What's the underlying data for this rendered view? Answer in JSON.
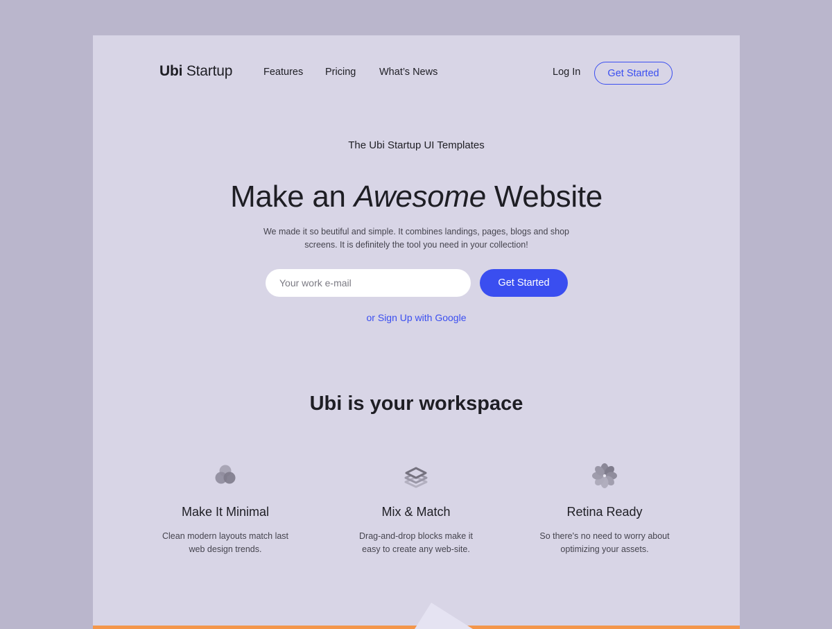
{
  "nav": {
    "brand_bold": "Ubi",
    "brand_regular": " Startup",
    "links": [
      "Features",
      "Pricing",
      "What’s News"
    ],
    "login_label": "Log In",
    "cta_label": "Get Started"
  },
  "hero": {
    "eyebrow": "The Ubi Startup UI Templates",
    "headline_pre": "Make an ",
    "headline_em": "Awesome",
    "headline_post": " Website",
    "subtext_line1": "We made it so beutiful and simple. It combines landings, pages, blogs and shop",
    "subtext_line2": "screens. It is definitely the tool you need in your collection!",
    "email_placeholder": "Your work e-mail",
    "email_value": "",
    "cta_label": "Get Started",
    "google_link": "or Sign Up with Google"
  },
  "features": {
    "title": "Ubi is your workspace",
    "items": [
      {
        "icon": "circles-icon",
        "title": "Make It Minimal",
        "line1": "Clean modern layouts match last",
        "line2": "web design trends."
      },
      {
        "icon": "layers-icon",
        "title": "Mix & Match",
        "line1": "Drag-and-drop blocks make it",
        "line2": "easy to create any web-site."
      },
      {
        "icon": "flower-icon",
        "title": "Retina Ready",
        "line1": "So there's no need to worry about",
        "line2": "optimizing your assets."
      }
    ]
  },
  "colors": {
    "background": "#bab6cc",
    "surface": "#d8d5e6",
    "accent": "#3a4ef0",
    "bottom_bar": "#f4964a"
  }
}
